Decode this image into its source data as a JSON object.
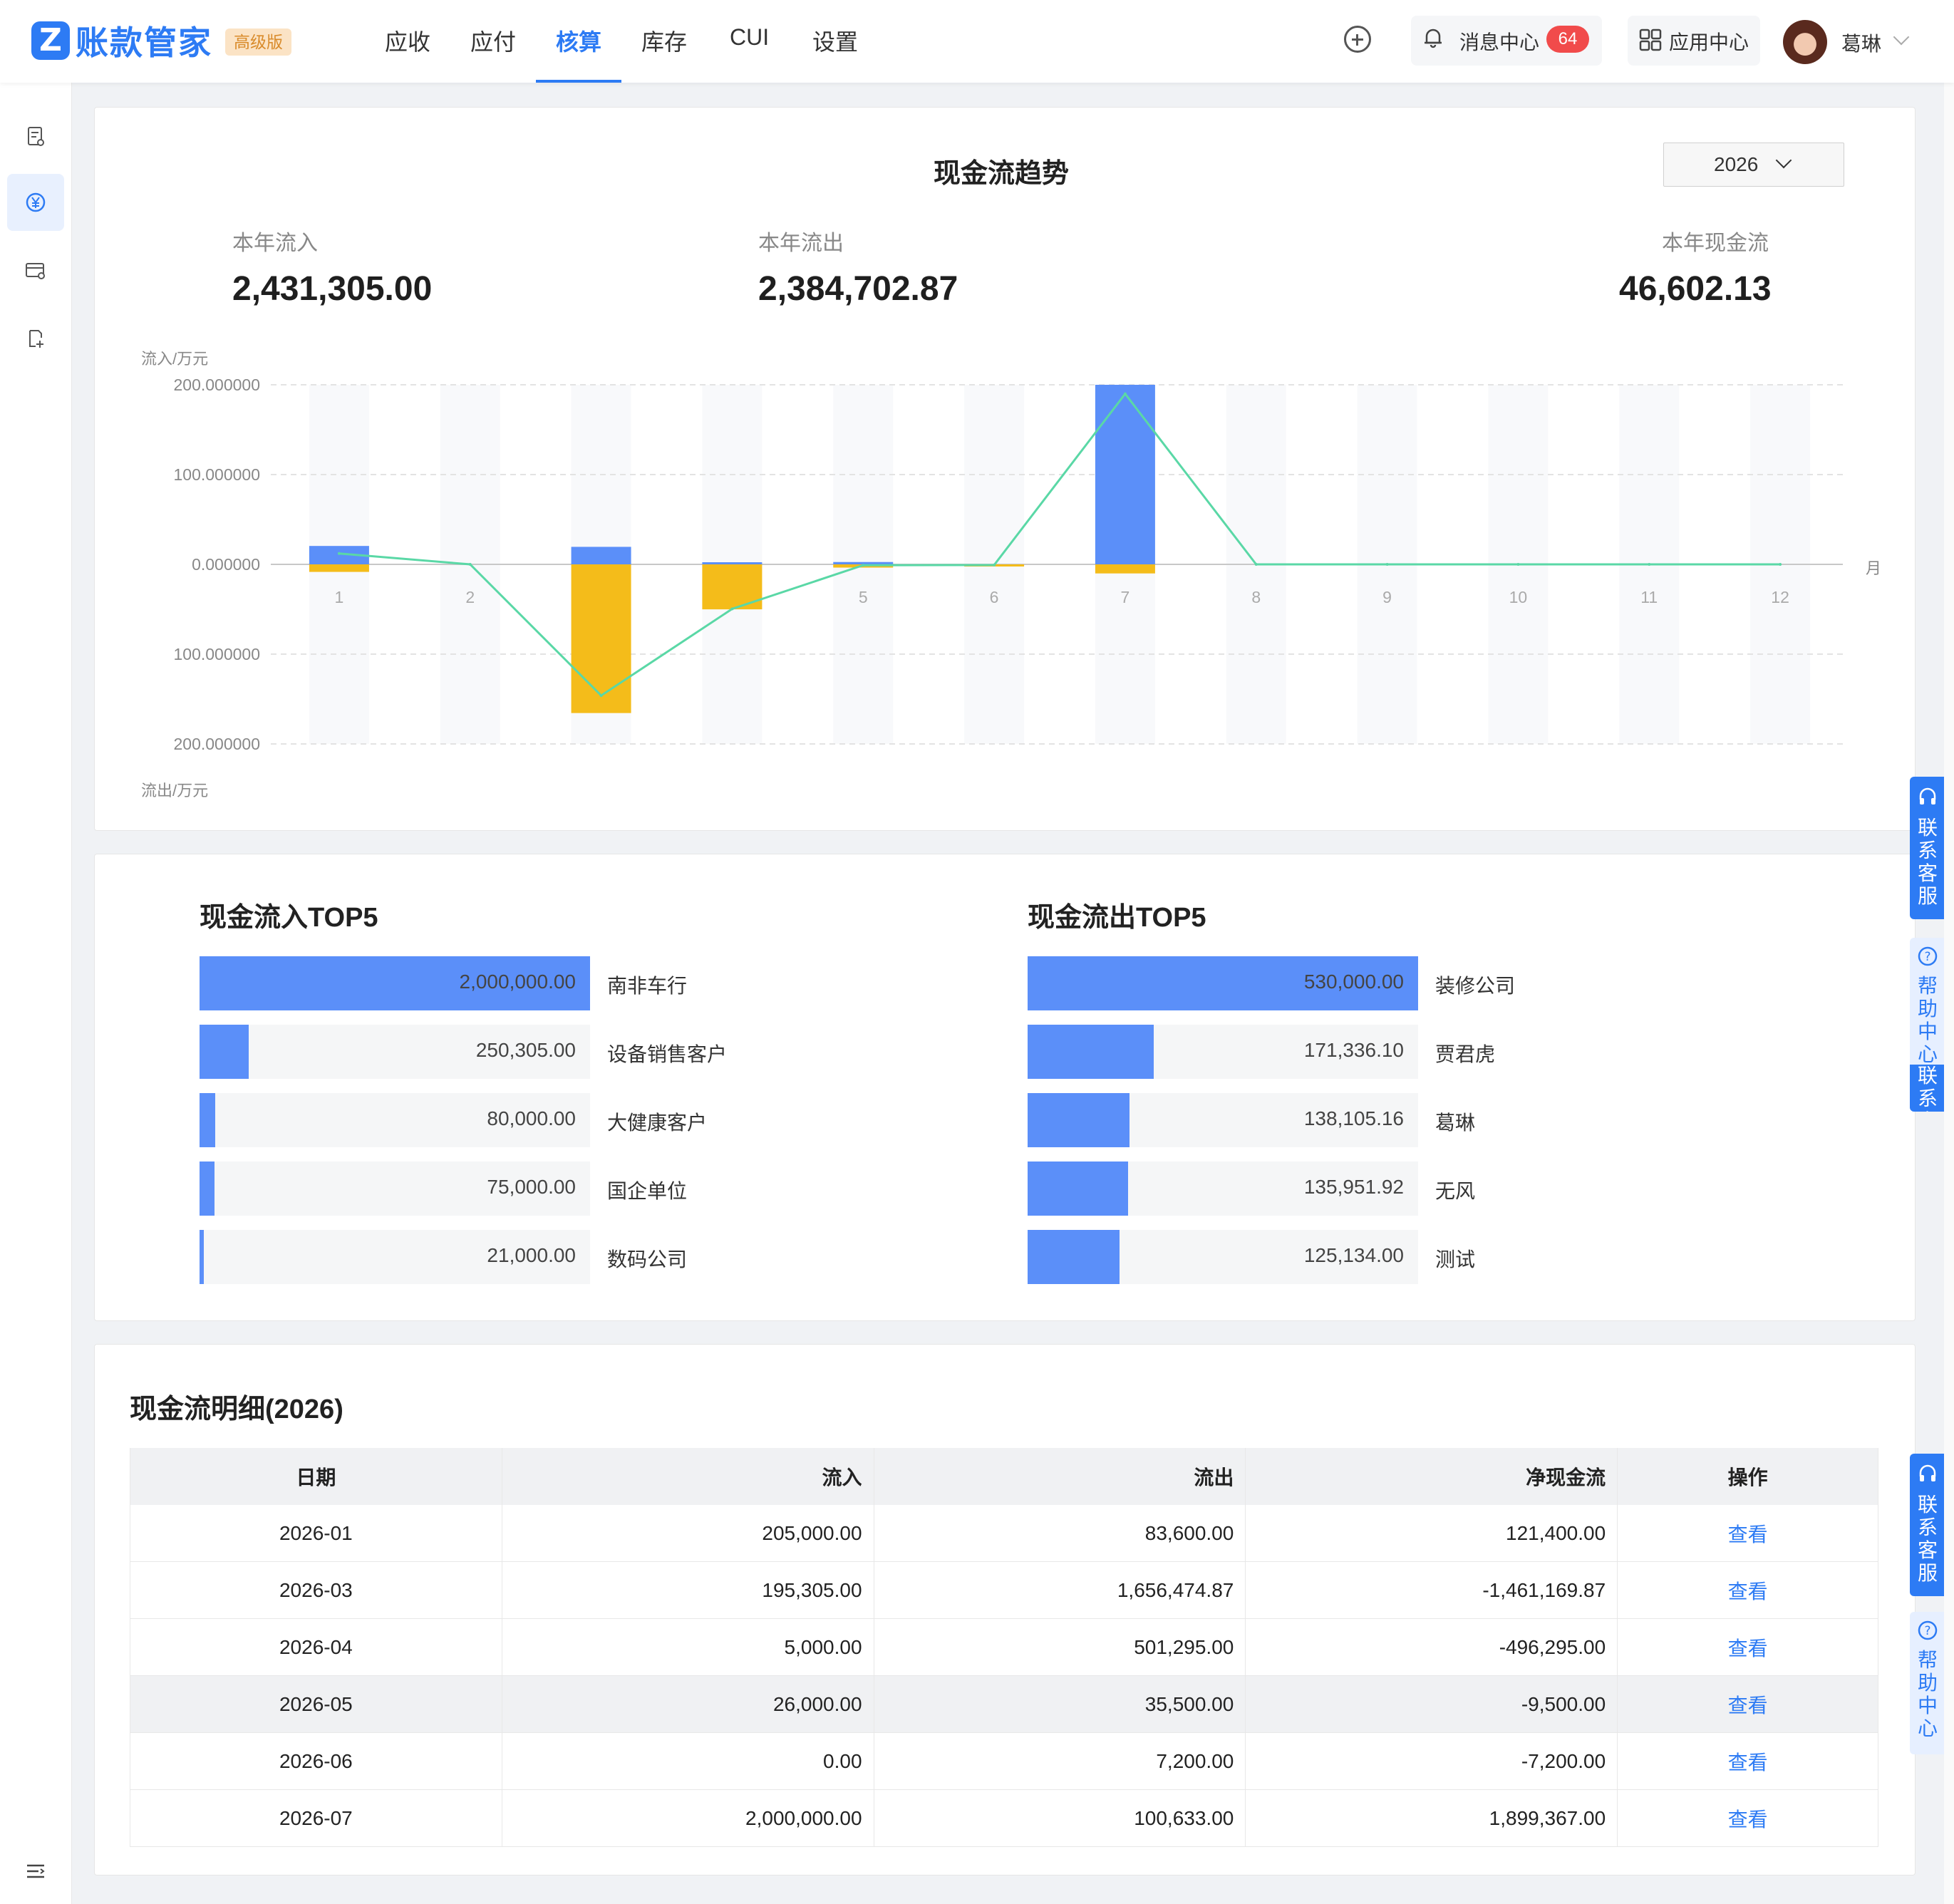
{
  "app": {
    "logo_letter": "Z",
    "title": "账款管家",
    "edition": "高级版"
  },
  "nav": {
    "items": [
      {
        "label": "应收"
      },
      {
        "label": "应付"
      },
      {
        "label": "核算"
      },
      {
        "label": "库存"
      },
      {
        "label": "CUI"
      },
      {
        "label": "设置"
      }
    ],
    "active": "核算"
  },
  "header": {
    "messages_label": "消息中心",
    "messages_count": "64",
    "app_center_label": "应用中心",
    "user_name": "葛琳"
  },
  "trend": {
    "title": "现金流趋势",
    "year": "2026",
    "inflow_label": "本年流入",
    "inflow_value": "2,431,305.00",
    "outflow_label": "本年流出",
    "outflow_value": "2,384,702.87",
    "net_label": "本年现金流",
    "net_value": "46,602.13",
    "y_top_label": "流入/万元",
    "y_bottom_label": "流出/万元",
    "x_unit": "月"
  },
  "chart_data": {
    "type": "bar",
    "title": "现金流趋势",
    "categories": [
      "1",
      "2",
      "3",
      "4",
      "5",
      "6",
      "7",
      "8",
      "9",
      "10",
      "11",
      "12"
    ],
    "y_tick_labels": [
      "200.000000",
      "100.000000",
      "0.000000",
      "100.000000",
      "200.000000"
    ],
    "ylim": [
      -200,
      200
    ],
    "grid": true,
    "series": [
      {
        "kind": "bar",
        "color": "#5b8ff9",
        "values": [
          20.5,
          0,
          19.5,
          0.5,
          2.6,
          0,
          200,
          0,
          0,
          0,
          0,
          0
        ]
      },
      {
        "kind": "bar",
        "color": "#f4bc1a",
        "values": [
          -8.4,
          0,
          -165.6,
          -50.1,
          -3.6,
          -0.7,
          -10.1,
          0,
          0,
          0,
          0,
          0
        ]
      },
      {
        "kind": "line",
        "color": "#5ad8a6",
        "values": [
          12.1,
          0,
          -146.1,
          -49.6,
          -1.0,
          -0.7,
          189.9,
          0,
          0,
          0,
          0,
          0
        ]
      }
    ]
  },
  "inflow_top5": {
    "title": "现金流入TOP5",
    "items": [
      {
        "name": "南非车行",
        "value": "2,000,000.00",
        "ratio": 1.0
      },
      {
        "name": "设备销售客户",
        "value": "250,305.00",
        "ratio": 0.125
      },
      {
        "name": "大健康客户",
        "value": "80,000.00",
        "ratio": 0.04
      },
      {
        "name": "国企单位",
        "value": "75,000.00",
        "ratio": 0.0375
      },
      {
        "name": "数码公司",
        "value": "21,000.00",
        "ratio": 0.0105
      }
    ]
  },
  "outflow_top5": {
    "title": "现金流出TOP5",
    "items": [
      {
        "name": "装修公司",
        "value": "530,000.00",
        "ratio": 1.0
      },
      {
        "name": "贾君虎",
        "value": "171,336.10",
        "ratio": 0.3233
      },
      {
        "name": "葛琳",
        "value": "138,105.16",
        "ratio": 0.2606
      },
      {
        "name": "无风",
        "value": "135,951.92",
        "ratio": 0.2565
      },
      {
        "name": "测试",
        "value": "125,134.00",
        "ratio": 0.2361
      }
    ]
  },
  "detail": {
    "title": "现金流明细(2026)",
    "columns": [
      "日期",
      "流入",
      "流出",
      "净现金流",
      "操作"
    ],
    "action_label": "查看",
    "rows": [
      {
        "date": "2026-01",
        "inflow": "205,000.00",
        "outflow": "83,600.00",
        "net": "121,400.00"
      },
      {
        "date": "2026-03",
        "inflow": "195,305.00",
        "outflow": "1,656,474.87",
        "net": "-1,461,169.87"
      },
      {
        "date": "2026-04",
        "inflow": "5,000.00",
        "outflow": "501,295.00",
        "net": "-496,295.00"
      },
      {
        "date": "2026-05",
        "inflow": "26,000.00",
        "outflow": "35,500.00",
        "net": "-9,500.00"
      },
      {
        "date": "2026-06",
        "inflow": "0.00",
        "outflow": "7,200.00",
        "net": "-7,200.00"
      },
      {
        "date": "2026-07",
        "inflow": "2,000,000.00",
        "outflow": "100,633.00",
        "net": "1,899,367.00"
      }
    ]
  },
  "float_buttons": {
    "contact": "联系客服",
    "help": "帮助中心"
  },
  "colors": {
    "accent": "#2d7bf4",
    "inflow_bar": "#5b8ff9",
    "outflow_bar": "#f4bc1a",
    "net_line": "#5ad8a6"
  }
}
